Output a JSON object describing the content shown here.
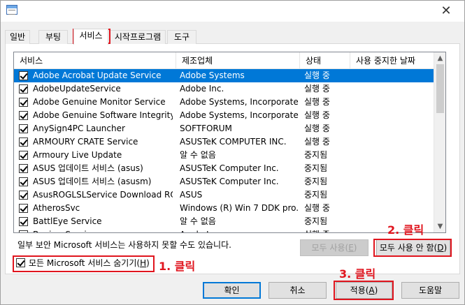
{
  "tabs": [
    {
      "label": "일반"
    },
    {
      "label": "부팅"
    },
    {
      "label": "서비스"
    },
    {
      "label": "시작프로그램"
    },
    {
      "label": "도구"
    }
  ],
  "close_glyph": "✕",
  "columns": [
    "서비스",
    "제조업체",
    "상태",
    "사용 중지한 날짜"
  ],
  "services": [
    {
      "name": "Adobe Acrobat Update Service",
      "vendor": "Adobe Systems",
      "status": "실행 중",
      "checked": true,
      "selected": true
    },
    {
      "name": "AdobeUpdateService",
      "vendor": "Adobe Inc.",
      "status": "실행 중",
      "checked": true
    },
    {
      "name": "Adobe Genuine Monitor Service",
      "vendor": "Adobe Systems, Incorporated",
      "status": "실행 중",
      "checked": true
    },
    {
      "name": "Adobe Genuine Software Integrity S...",
      "vendor": "Adobe Systems, Incorporated",
      "status": "실행 중",
      "checked": true
    },
    {
      "name": "AnySign4PC Launcher",
      "vendor": "SOFTFORUM",
      "status": "실행 중",
      "checked": true
    },
    {
      "name": "ARMOURY CRATE Service",
      "vendor": "ASUSTeK COMPUTER INC.",
      "status": "실행 중",
      "checked": true
    },
    {
      "name": "Armoury Live Update",
      "vendor": "알 수 없음",
      "status": "중지됨",
      "checked": true
    },
    {
      "name": "ASUS 업데이트 서비스 (asus)",
      "vendor": "ASUSTeK Computer Inc.",
      "status": "중지됨",
      "checked": true
    },
    {
      "name": "ASUS 업데이트 서비스 (asusm)",
      "vendor": "ASUSTeK Computer Inc.",
      "status": "중지됨",
      "checked": true
    },
    {
      "name": "AsusROGLSLService Download ROG...",
      "vendor": "ASUS",
      "status": "중지됨",
      "checked": true
    },
    {
      "name": "AtherosSvc",
      "vendor": "Windows (R) Win 7 DDK pro...",
      "status": "실행 중",
      "checked": true
    },
    {
      "name": "BattlEye Service",
      "vendor": "알 수 없음",
      "status": "중지됨",
      "checked": true
    },
    {
      "name": "BonjourService",
      "vendor": "Apple Inc.",
      "status": "실행 중",
      "checked": true
    }
  ],
  "note": "일부 보안 Microsoft 서비스는 사용하지 못할 수도 있습니다.",
  "enable_all": {
    "label": "모두 사용(",
    "key": "E",
    "tail": ")"
  },
  "disable_all": {
    "label": "모두 사용 안 함(",
    "key": "D",
    "tail": ")"
  },
  "hide_ms": {
    "label": "모든 Microsoft 서비스 숨기기(",
    "key": "H",
    "tail": ")",
    "checked": true
  },
  "buttons": {
    "ok": "확인",
    "cancel": "취소",
    "apply_label": "적용(",
    "apply_key": "A",
    "apply_tail": ")",
    "help": "도움말"
  },
  "annotations": {
    "step1": "1. 클릭",
    "step2": "2. 클릭",
    "step3": "3. 클릭",
    "color": "#e0151e"
  },
  "colors": {
    "selection": "#0078d7",
    "window_bg": "#f0f0f0"
  }
}
